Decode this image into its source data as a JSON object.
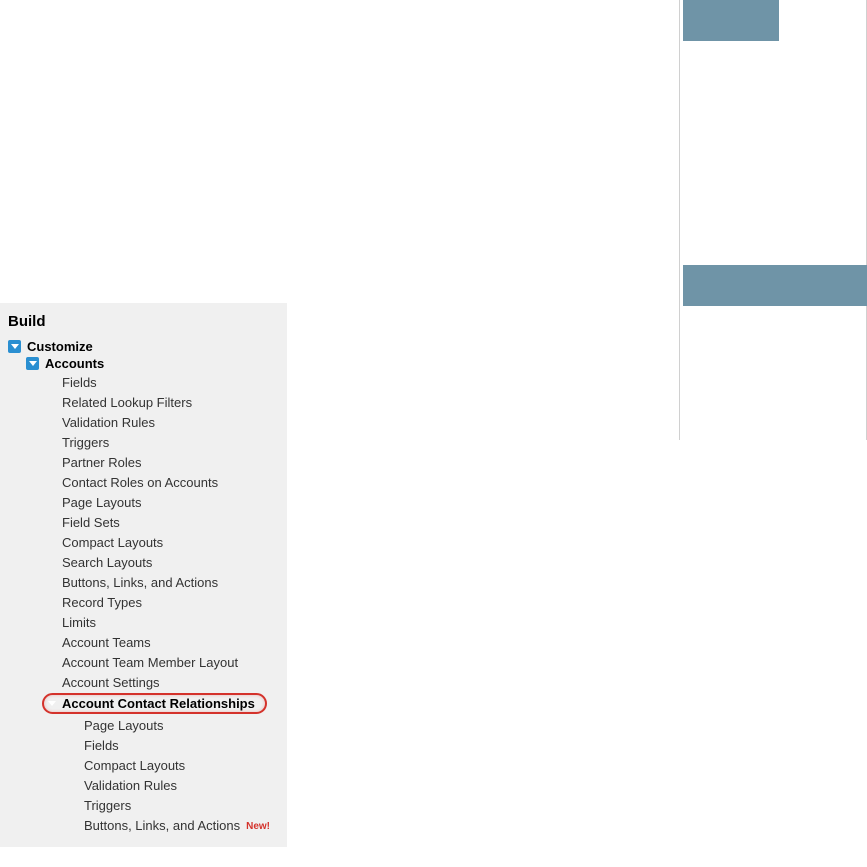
{
  "section_header": "Build",
  "customize": {
    "label": "Customize",
    "accounts": {
      "label": "Accounts",
      "items": [
        "Fields",
        "Related Lookup Filters",
        "Validation Rules",
        "Triggers",
        "Partner Roles",
        "Contact Roles on Accounts",
        "Page Layouts",
        "Field Sets",
        "Compact Layouts",
        "Search Layouts",
        "Buttons, Links, and Actions",
        "Record Types",
        "Limits",
        "Account Teams",
        "Account Team Member Layout",
        "Account Settings"
      ],
      "acr": {
        "label": "Account Contact Relationships",
        "items": [
          "Page Layouts",
          "Fields",
          "Compact Layouts",
          "Validation Rules",
          "Triggers",
          "Buttons, Links, and Actions"
        ],
        "new_badge": "New!"
      }
    }
  }
}
